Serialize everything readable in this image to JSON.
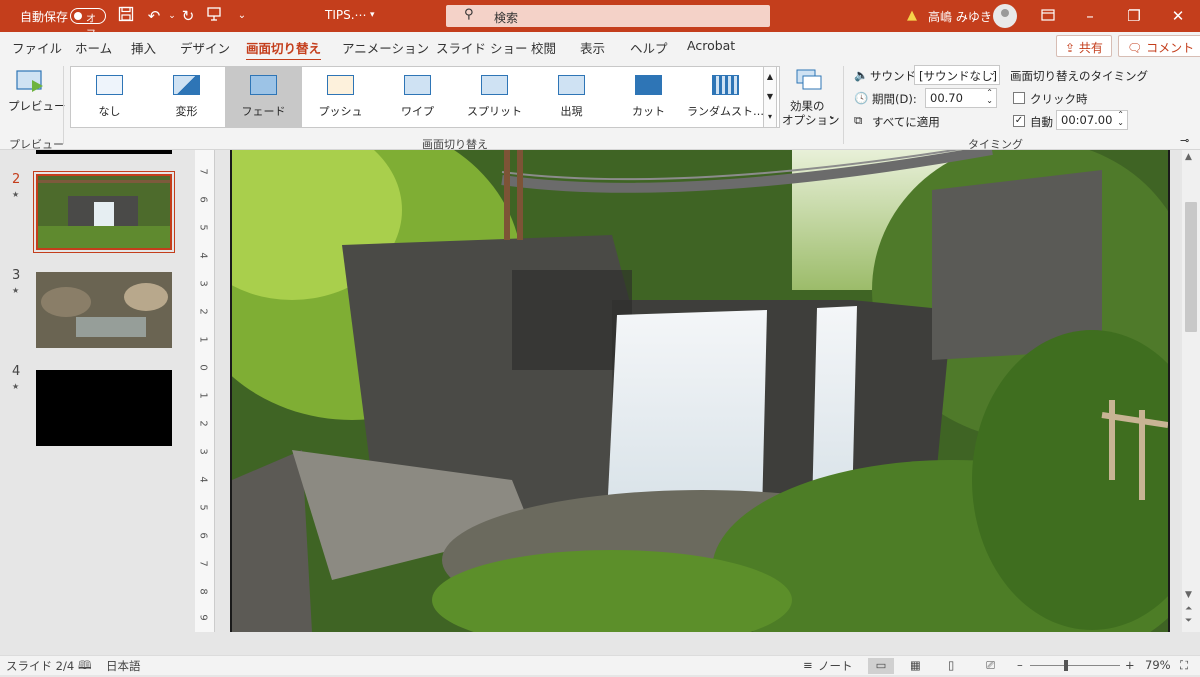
{
  "titlebar": {
    "autosave_label": "自動保存",
    "autosave_state": "オフ",
    "doc_title": "TIPS.⋯",
    "search_placeholder": "検索",
    "user_name": "高嶋 みゆき"
  },
  "tabs": [
    "ファイル",
    "ホーム",
    "挿入",
    "デザイン",
    "画面切り替え",
    "アニメーション",
    "スライド ショー",
    "校閲",
    "表示",
    "ヘルプ",
    "Acrobat"
  ],
  "share_label": "共有",
  "comment_label": "コメント",
  "ribbon": {
    "preview_label": "プレビュー",
    "preview_group": "プレビュー",
    "transitions": [
      "なし",
      "変形",
      "フェード",
      "プッシュ",
      "ワイプ",
      "スプリット",
      "出現",
      "カット",
      "ランダムスト…"
    ],
    "selected_transition": "フェード",
    "effect_options_line1": "効果の",
    "effect_options_line2": "オプション",
    "transitions_group": "画面切り替え",
    "sound_label": "サウンド:",
    "sound_value": "[サウンドなし]",
    "duration_label": "期間(D):",
    "duration_value": "00.70",
    "apply_all_label": "すべてに適用",
    "advance_title": "画面切り替えのタイミング",
    "on_click_label": "クリック時",
    "after_label": "自動",
    "after_value": "00:07.00",
    "timing_group": "タイミング"
  },
  "slides": [
    {
      "num": "2",
      "active": true
    },
    {
      "num": "3",
      "active": false
    },
    {
      "num": "4",
      "active": false
    }
  ],
  "ruler": [
    "7",
    "6",
    "5",
    "4",
    "3",
    "2",
    "1",
    "0",
    "1",
    "2",
    "3",
    "4",
    "5",
    "6",
    "7",
    "8",
    "9"
  ],
  "status": {
    "slide_info": "スライド 2/4",
    "language": "日本語",
    "notes_label": "ノート",
    "zoom": "79%"
  }
}
